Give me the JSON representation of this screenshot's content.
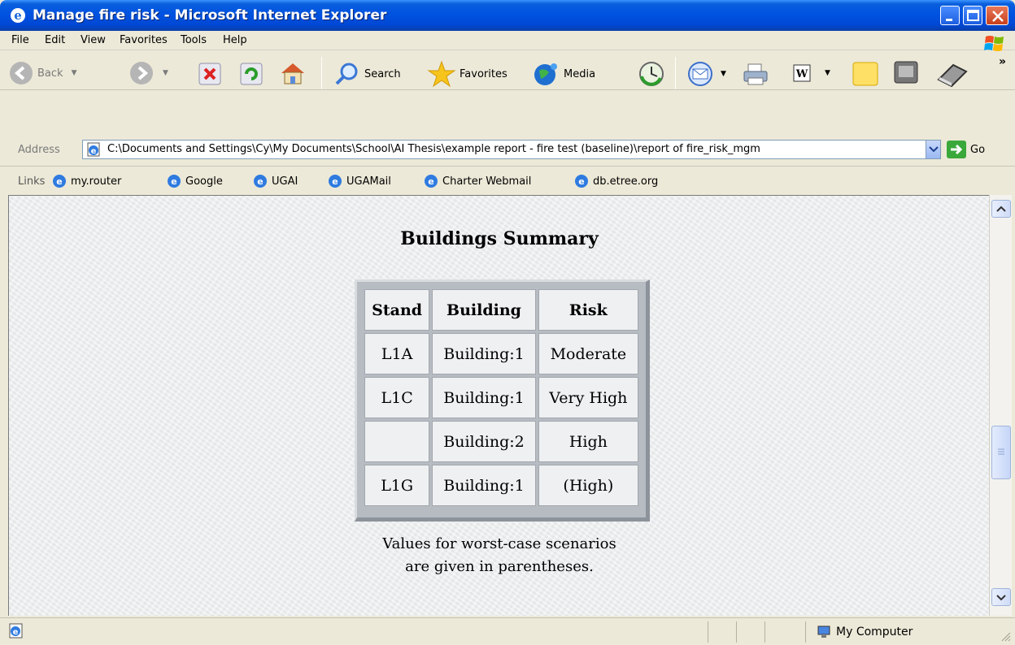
{
  "window": {
    "title": "Manage fire risk - Microsoft Internet Explorer"
  },
  "menu": {
    "file": "File",
    "edit": "Edit",
    "view": "View",
    "favorites": "Favorites",
    "tools": "Tools",
    "help": "Help"
  },
  "toolbar": {
    "back": "Back",
    "search": "Search",
    "favorites": "Favorites",
    "media": "Media",
    "overflow": "»"
  },
  "address": {
    "label": "Address",
    "value": "C:\\Documents and Settings\\Cy\\My Documents\\School\\AI Thesis\\example report - fire test (baseline)\\report of fire_risk_mgm",
    "go": "Go"
  },
  "links": {
    "label": "Links",
    "items": [
      "my.router",
      "Google",
      "UGAI",
      "UGAMail",
      "Charter Webmail",
      "db.etree.org"
    ]
  },
  "page": {
    "title": "Buildings Summary",
    "table": {
      "headers": [
        "Stand",
        "Building",
        "Risk"
      ],
      "rows": [
        [
          "L1A",
          "Building:1",
          "Moderate"
        ],
        [
          "L1C",
          "Building:1",
          "Very High"
        ],
        [
          "",
          "Building:2",
          "High"
        ],
        [
          "L1G",
          "Building:1",
          "(High)"
        ]
      ]
    },
    "caption_line1": "Values for worst-case scenarios",
    "caption_line2": "are given in parentheses."
  },
  "status": {
    "zone": "My Computer"
  }
}
